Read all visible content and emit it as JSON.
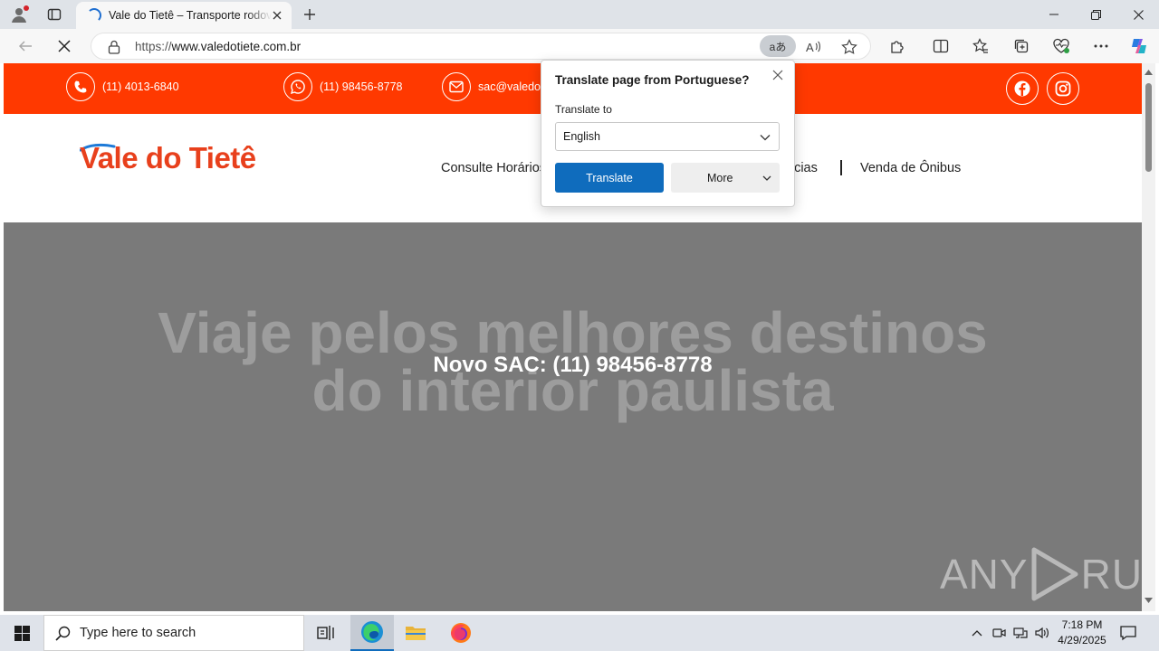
{
  "browser": {
    "tab_title": "Vale do Tietê – Transporte rodoviário",
    "url_prefix": "https://",
    "url_host": "www.valedotiete.com.br",
    "translate_pill": "aあ"
  },
  "site": {
    "contacts": [
      {
        "icon": "phone-icon",
        "text": "(11) 4013-6840"
      },
      {
        "icon": "whatsapp-icon",
        "text": "(11) 98456-8778"
      },
      {
        "icon": "mail-icon",
        "text": "sac@valedo"
      }
    ],
    "logo_text": "Vale do Tietê",
    "nav": {
      "consulte": "Consulte Horários",
      "agencias_partial": "ncias",
      "venda": "Venda de Ônibus"
    },
    "hero": {
      "title_line1": "Viaje pelos melhores destinos",
      "title_line2": "do interior paulista",
      "sac": "Novo SAC: (11) 98456-8778"
    },
    "brand_color": "#ff3900"
  },
  "translate_popup": {
    "title": "Translate page from Portuguese?",
    "label": "Translate to",
    "selected_language": "English",
    "translate_button": "Translate",
    "more_button": "More"
  },
  "watermark": {
    "left": "ANY",
    "right": "RUN"
  },
  "taskbar": {
    "search_placeholder": "Type here to search",
    "time": "7:18 PM",
    "date": "4/29/2025"
  }
}
